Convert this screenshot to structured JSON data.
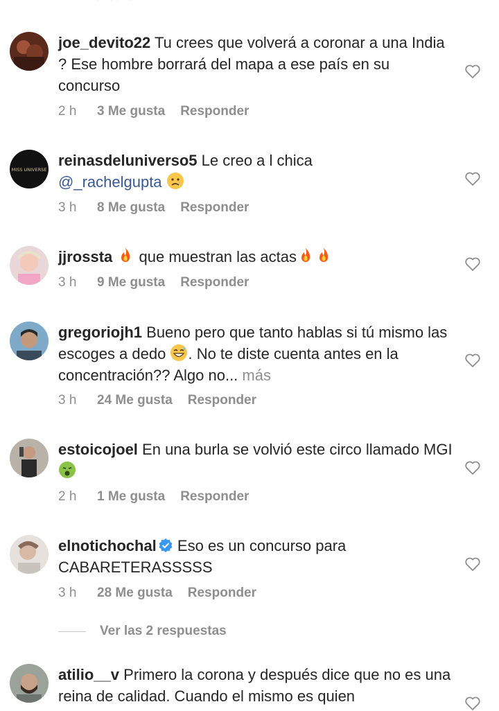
{
  "comments": [
    {
      "username": "joe_devito22",
      "text": "Tu crees que volverá a coronar a una India ? Ese hombre borrará del mapa a ese país en su concurso",
      "time": "2 h",
      "likes": "3 Me gusta",
      "reply": "Responder"
    },
    {
      "username": "reinasdeluniverso5",
      "text": "Le creo a l chica",
      "mention": "@_rachelgupta",
      "time": "3 h",
      "likes": "8 Me gusta",
      "reply": "Responder",
      "avatar_text": "MISS UNIVERSE"
    },
    {
      "username": "jjrossta",
      "text_a": "que muestran las actas",
      "time": "3 h",
      "likes": "9 Me gusta",
      "reply": "Responder"
    },
    {
      "username": "gregoriojh1",
      "text_a": "Bueno pero que tanto hablas si tú mismo las escoges a dedo",
      "text_b": ". No te diste cuenta antes en la concentración?? Algo no...",
      "more": "más",
      "time": "3 h",
      "likes": "24 Me gusta",
      "reply": "Responder"
    },
    {
      "username": "estoicojoel",
      "text": "En una burla se volvió este circo llamado MGI",
      "time": "2 h",
      "likes": "1 Me gusta",
      "reply": "Responder"
    },
    {
      "username": "elnotichochal",
      "text": "Eso es un concurso para CABARETERASSSSS",
      "time": "3 h",
      "likes": "28 Me gusta",
      "reply": "Responder"
    },
    {
      "username": "atilio__v",
      "text": "Primero la corona y después dice que no es una reina de calidad. Cuando el mismo es quien"
    }
  ],
  "view_replies": "Ver las 2 respuestas",
  "colors": {
    "text": "#262626",
    "muted": "#8e8e8e",
    "mention": "#385898",
    "verified": "#3897f0"
  },
  "icons": [
    "heart-outline-icon",
    "fire-emoji",
    "sad-emoji",
    "grin-sweat-emoji",
    "nauseated-emoji",
    "verified-badge-icon"
  ]
}
